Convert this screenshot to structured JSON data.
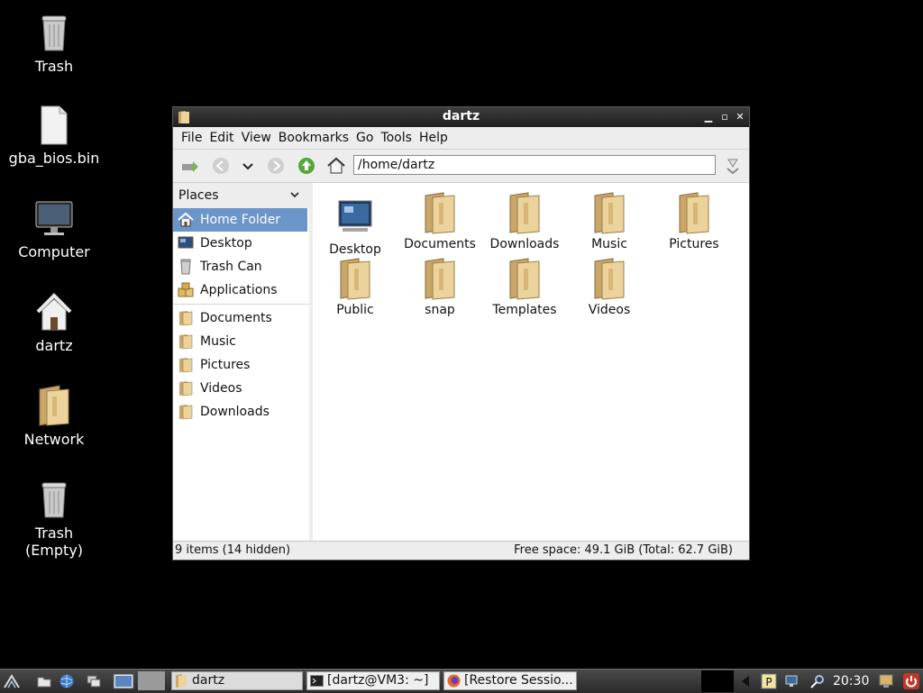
{
  "desktop": {
    "icons": [
      {
        "label": "Trash",
        "icon": "trash-full-icon"
      },
      {
        "label": "gba_bios.bin",
        "icon": "file-icon"
      },
      {
        "label": "Computer",
        "icon": "computer-icon"
      },
      {
        "label": "dartz",
        "icon": "home-icon"
      },
      {
        "label": "Network",
        "icon": "folder-icon"
      },
      {
        "label": "Trash\n(Empty)",
        "icon": "trash-empty-icon"
      }
    ]
  },
  "window": {
    "title": "dartz",
    "menu": [
      "File",
      "Edit",
      "View",
      "Bookmarks",
      "Go",
      "Tools",
      "Help"
    ],
    "address": "/home/dartz",
    "sidebar": {
      "header": "Places",
      "places": [
        {
          "label": "Home Folder",
          "icon": "home-icon",
          "selected": true
        },
        {
          "label": "Desktop",
          "icon": "desktop-icon"
        },
        {
          "label": "Trash Can",
          "icon": "trash-icon"
        },
        {
          "label": "Applications",
          "icon": "applications-icon"
        }
      ],
      "bookmarks": [
        {
          "label": "Documents",
          "icon": "folder-icon"
        },
        {
          "label": "Music",
          "icon": "folder-icon"
        },
        {
          "label": "Pictures",
          "icon": "folder-icon"
        },
        {
          "label": "Videos",
          "icon": "folder-icon"
        },
        {
          "label": "Downloads",
          "icon": "folder-icon"
        }
      ]
    },
    "files": [
      {
        "label": "Desktop",
        "icon": "desktop-icon"
      },
      {
        "label": "Documents",
        "icon": "folder-icon"
      },
      {
        "label": "Downloads",
        "icon": "folder-icon"
      },
      {
        "label": "Music",
        "icon": "folder-icon"
      },
      {
        "label": "Pictures",
        "icon": "folder-icon"
      },
      {
        "label": "Public",
        "icon": "folder-icon"
      },
      {
        "label": "snap",
        "icon": "folder-icon"
      },
      {
        "label": "Templates",
        "icon": "folder-icon"
      },
      {
        "label": "Videos",
        "icon": "folder-icon"
      }
    ],
    "status": {
      "items": "9 items (14 hidden)",
      "space": "Free space: 49.1 GiB (Total: 62.7 GiB)"
    }
  },
  "taskbar": {
    "tasks": [
      {
        "label": "dartz",
        "icon": "folder-icon"
      },
      {
        "label": "[dartz@VM3: ~]",
        "icon": "terminal-icon"
      },
      {
        "label": "[Restore Sessio...",
        "icon": "firefox-icon"
      }
    ],
    "clock": "20:30"
  },
  "colors": {
    "selection": "#6c95c9",
    "desktop_bg": "#000000",
    "folder": "#e8c98a"
  }
}
